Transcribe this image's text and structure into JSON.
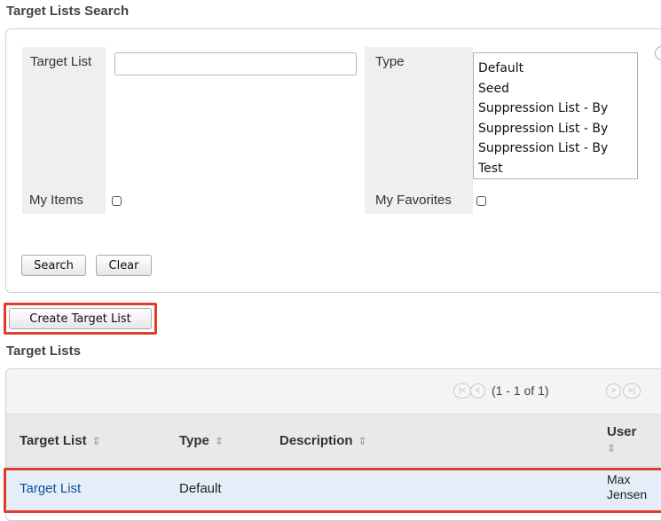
{
  "search": {
    "title": "Target Lists Search",
    "target_list_label": "Target List",
    "target_list_value": "",
    "type_label": "Type",
    "type_options": [
      "Default",
      "Seed",
      "Suppression List - By",
      "Suppression List - By",
      "Suppression List - By",
      "Test"
    ],
    "my_items_label": "My Items",
    "my_favorites_label": "My Favorites",
    "search_button": "Search",
    "clear_button": "Clear"
  },
  "create_button": "Create Target List",
  "list": {
    "title": "Target Lists",
    "pagination": "(1 - 1 of 1)",
    "columns": [
      "Target List",
      "Type",
      "Description",
      "User"
    ],
    "rows": [
      {
        "name": "Target List",
        "type": "Default",
        "description": "",
        "user_line1": "Max",
        "user_line2": "Jensen"
      }
    ]
  },
  "icons": [
    "sort-icon",
    "first-page-icon",
    "previous-page-icon",
    "next-page-icon",
    "last-page-icon",
    "help-icon"
  ],
  "colors": {
    "highlight": "#e23d2a",
    "link": "#0b4f9c",
    "row_selected": "#e5eef8"
  }
}
